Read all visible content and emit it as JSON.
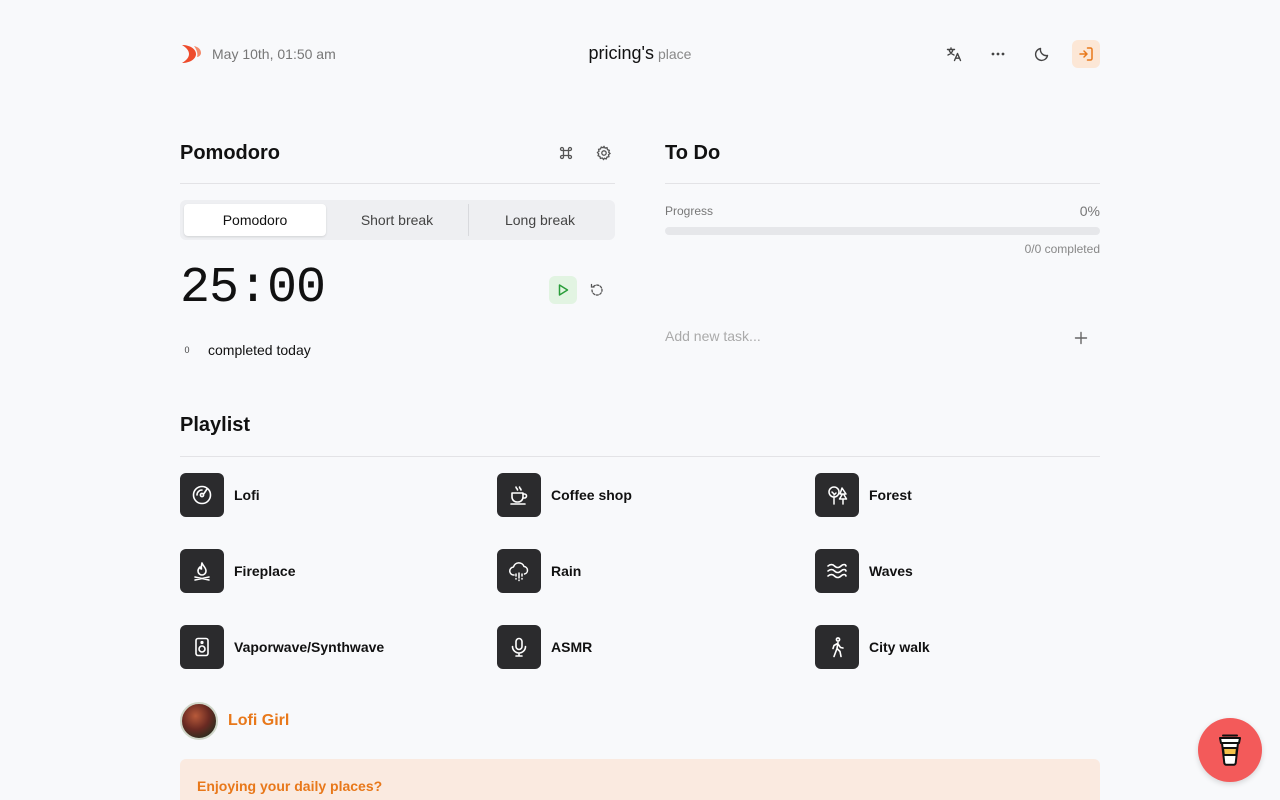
{
  "header": {
    "date": "May 10th, 01:50 am",
    "owner": "pricing's",
    "owner_suffix": "place",
    "icons": [
      "translate-icon",
      "more-icon",
      "moon-icon",
      "login-icon"
    ]
  },
  "pomodoro": {
    "title": "Pomodoro",
    "tabs": [
      {
        "label": "Pomodoro",
        "active": true
      },
      {
        "label": "Short break",
        "active": false
      },
      {
        "label": "Long break",
        "active": false
      }
    ],
    "time": "25:00",
    "completed_count": "0",
    "completed_label": "completed today"
  },
  "todo": {
    "title": "To Do",
    "progress_label": "Progress",
    "progress_percent": "0%",
    "progress_value": 0,
    "progress_count": "0/0 completed",
    "input_placeholder": "Add new task..."
  },
  "playlist": {
    "title": "Playlist",
    "items": [
      {
        "label": "Lofi",
        "icon": "vinyl-icon"
      },
      {
        "label": "Coffee shop",
        "icon": "coffee-icon"
      },
      {
        "label": "Forest",
        "icon": "tree-icon"
      },
      {
        "label": "Fireplace",
        "icon": "flame-icon"
      },
      {
        "label": "Rain",
        "icon": "cloud-rain-icon"
      },
      {
        "label": "Waves",
        "icon": "waves-icon"
      },
      {
        "label": "Vaporwave/Synthwave",
        "icon": "speaker-icon"
      },
      {
        "label": "ASMR",
        "icon": "microphone-icon"
      },
      {
        "label": "City walk",
        "icon": "walking-icon"
      }
    ],
    "creator": "Lofi Girl"
  },
  "banner": {
    "text": "Enjoying your daily places?"
  },
  "colors": {
    "accent": "#e8781a",
    "coffee_button": "#f35a5a",
    "play_bg": "#e2f4e2"
  }
}
